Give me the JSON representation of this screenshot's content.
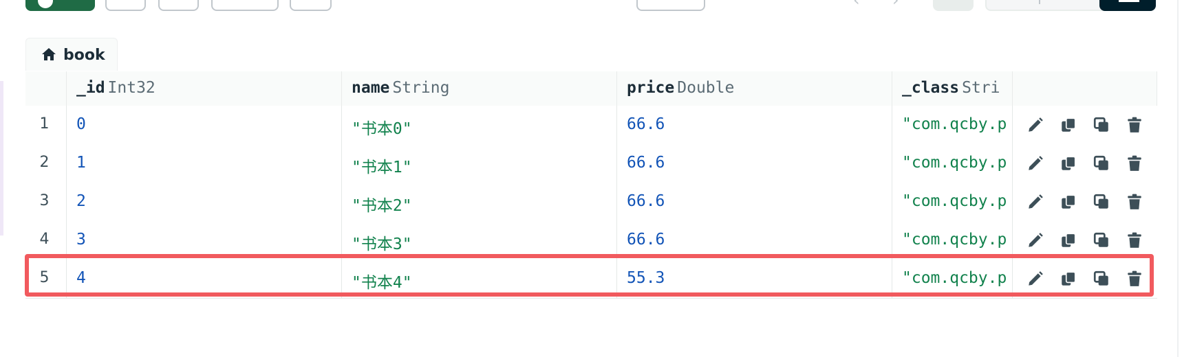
{
  "collection_tab": {
    "label": "book",
    "icon": "home-icon"
  },
  "table": {
    "columns": [
      {
        "name": "_id",
        "type": "Int32"
      },
      {
        "name": "name",
        "type": "String"
      },
      {
        "name": "price",
        "type": "Double"
      },
      {
        "name": "_class",
        "type": "Stri"
      }
    ],
    "rows": [
      {
        "num": "1",
        "id": "0",
        "name": "\"书本0\"",
        "price": "66.6",
        "class": "\"com.qcby.p"
      },
      {
        "num": "2",
        "id": "1",
        "name": "\"书本1\"",
        "price": "66.6",
        "class": "\"com.qcby.p"
      },
      {
        "num": "3",
        "id": "2",
        "name": "\"书本2\"",
        "price": "66.6",
        "class": "\"com.qcby.p"
      },
      {
        "num": "4",
        "id": "3",
        "name": "\"书本3\"",
        "price": "66.6",
        "class": "\"com.qcby.p"
      },
      {
        "num": "5",
        "id": "4",
        "name": "\"书本4\"",
        "price": "55.3",
        "class": "\"com.qcby.p"
      }
    ],
    "row_actions": [
      "edit-icon",
      "copy-icon",
      "clone-icon",
      "trash-icon"
    ],
    "highlighted_row": 5
  },
  "colors": {
    "number_value": "#1254b7",
    "string_value": "#12824d",
    "highlight_border": "#f15a5e",
    "primary_button": "#1f6b45"
  }
}
